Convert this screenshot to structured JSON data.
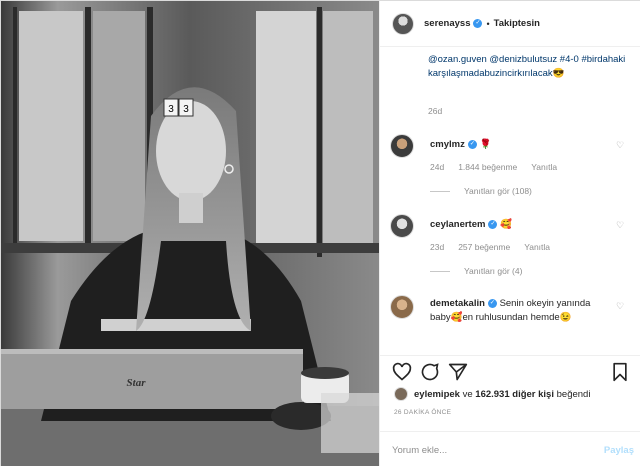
{
  "header": {
    "username": "serenayss",
    "verified_icon": "verified-badge-icon",
    "separator": "•",
    "follow_label": "Takiptesin"
  },
  "caption": {
    "mentions": "@ozan.guven @denizbulutsuz #4-0 #birdahakikarşılaşmadabuzincirkırılacak",
    "emoji": "😎",
    "time": "26d"
  },
  "comments": [
    {
      "username": "cmylmz",
      "emoji": "🌹",
      "time": "24d",
      "likes": "1.844 beğenme",
      "reply": "Yanıtla",
      "view_replies": "Yanıtları gör (108)"
    },
    {
      "username": "ceylanertem",
      "emoji": "🥰",
      "time": "23d",
      "likes": "257 beğenme",
      "reply": "Yanıtla",
      "view_replies": "Yanıtları gör (4)"
    },
    {
      "username": "demetakalin",
      "text": "Senin okeyin yanında baby",
      "emoji1": "🥰",
      "text2": "en ruhlusundan hemde",
      "emoji2": "😉"
    }
  ],
  "likes": {
    "user": "eylemipek",
    "rest": "ve",
    "count": "162.931 diğer kişi",
    "suffix": "beğendi"
  },
  "post_time": "26 DAKİKA ÖNCE",
  "comment_box": {
    "placeholder": "Yorum ekle...",
    "post_label": "Paylaş"
  },
  "photo": {
    "laptop_label": "Star",
    "tile_1": "3",
    "tile_2": "3"
  }
}
